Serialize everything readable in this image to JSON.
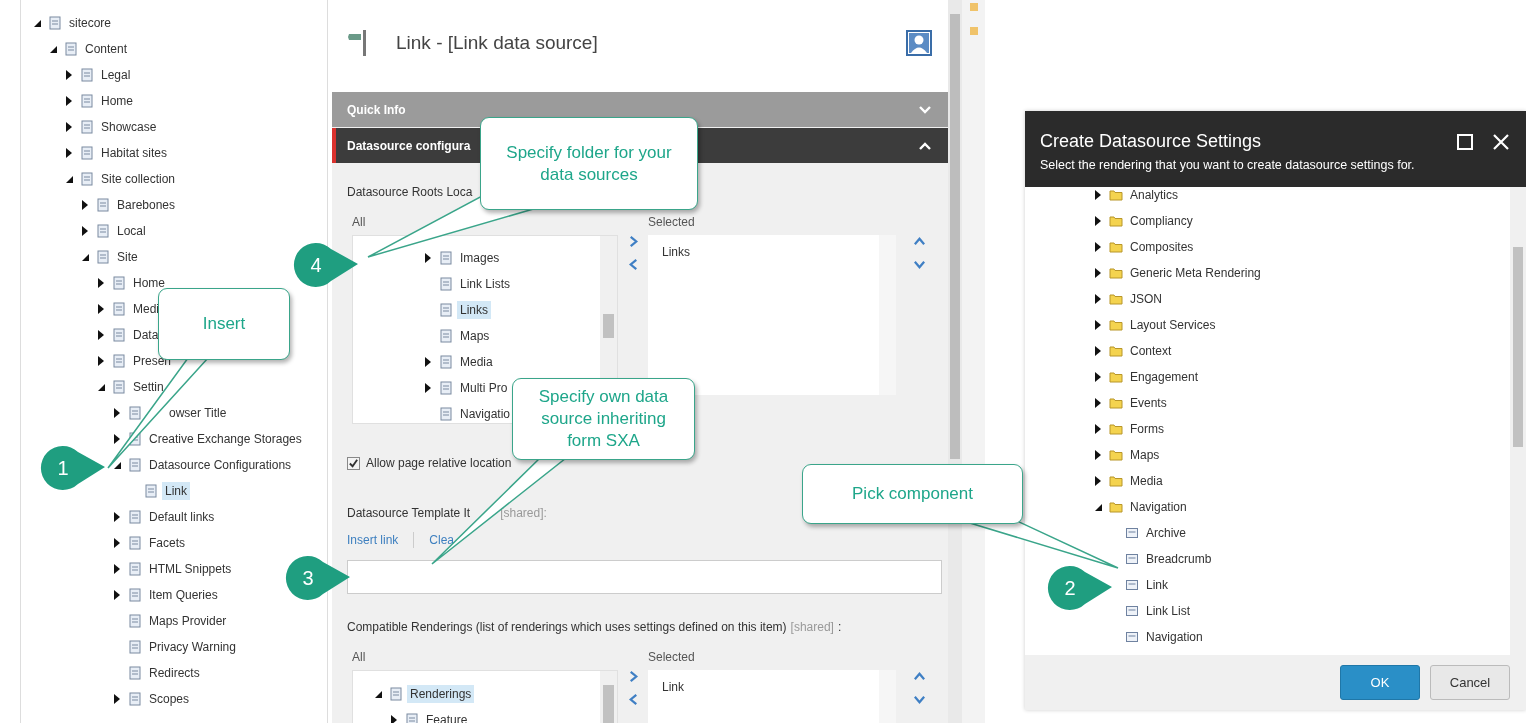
{
  "content_tree": {
    "items": [
      {
        "label": "sitecore",
        "expanded": true,
        "selected": false,
        "children": [
          {
            "label": "Content",
            "expanded": true,
            "selected": false,
            "children": [
              {
                "label": "Legal",
                "expanded": false,
                "selected": false
              },
              {
                "label": "Home",
                "expanded": false,
                "selected": false
              },
              {
                "label": "Showcase",
                "expanded": false,
                "selected": false
              },
              {
                "label": "Habitat sites",
                "expanded": false,
                "selected": false
              },
              {
                "label": "Site collection",
                "expanded": true,
                "selected": false,
                "children": [
                  {
                    "label": "Barebones",
                    "expanded": false,
                    "selected": false
                  },
                  {
                    "label": "Local",
                    "expanded": false,
                    "selected": false
                  },
                  {
                    "label": "Site",
                    "expanded": true,
                    "selected": false,
                    "children": [
                      {
                        "label": "Home",
                        "expanded": false,
                        "selected": false
                      },
                      {
                        "label": "Medi",
                        "expanded": false,
                        "selected": false
                      },
                      {
                        "label": "Data",
                        "expanded": false,
                        "selected": false
                      },
                      {
                        "label": "Presen",
                        "expanded": false,
                        "selected": false
                      },
                      {
                        "label": "Settin",
                        "expanded": true,
                        "selected": false,
                        "children": [
                          {
                            "label": "owser Title",
                            "expanded": false,
                            "selected": false
                          },
                          {
                            "label": "Creative Exchange Storages",
                            "expanded": false,
                            "selected": false
                          },
                          {
                            "label": "Datasource Configurations",
                            "expanded": true,
                            "selected": false,
                            "children": [
                              {
                                "label": "Link",
                                "selected": true
                              }
                            ]
                          },
                          {
                            "label": "Default links",
                            "expanded": false,
                            "selected": false
                          },
                          {
                            "label": "Facets",
                            "expanded": false,
                            "selected": false
                          },
                          {
                            "label": "HTML Snippets",
                            "expanded": false,
                            "selected": false
                          },
                          {
                            "label": "Item Queries",
                            "expanded": false,
                            "selected": false
                          },
                          {
                            "label": "Maps Provider",
                            "selected": false
                          },
                          {
                            "label": "Privacy Warning",
                            "selected": false
                          },
                          {
                            "label": "Redirects",
                            "selected": false
                          },
                          {
                            "label": "Scopes",
                            "expanded": false,
                            "selected": false
                          }
                        ]
                      }
                    ]
                  }
                ]
              }
            ]
          }
        ]
      }
    ]
  },
  "editor": {
    "title": "Link - [Link data source]",
    "sections": [
      {
        "title": "Quick Info",
        "expanded": false
      },
      {
        "title": "Datasource configura",
        "expanded": true
      }
    ],
    "roots_field": {
      "label": "Datasource Roots Loca",
      "all_label": "All",
      "selected_label": "Selected",
      "all_items": [
        {
          "label": "Images",
          "expanded": false,
          "selected": false
        },
        {
          "label": "Link Lists",
          "selected": false
        },
        {
          "label": "Links",
          "selected": true
        },
        {
          "label": "Maps",
          "selected": false
        },
        {
          "label": "Media",
          "expanded": false,
          "selected": false
        },
        {
          "label": "Multi Pro",
          "expanded": false,
          "selected": false
        },
        {
          "label": "Navigatio",
          "selected": false
        }
      ],
      "selected_items": [
        "Links"
      ]
    },
    "relative_location": {
      "label": "Allow page relative location",
      "checked": true
    },
    "template_field": {
      "label": "Datasource Template It",
      "shared": "[shared]:",
      "links": [
        "Insert link",
        "Clea"
      ]
    },
    "renderings_field": {
      "label": "Compatible Renderings (list of renderings which uses settings defined on this item)",
      "shared": "[shared]",
      "suffix": ":",
      "all_label": "All",
      "selected_label": "Selected",
      "all_items": [
        {
          "label": "Renderings",
          "expanded": true,
          "selected": true,
          "children": [
            {
              "label": "Feature",
              "expanded": false,
              "selected": false
            }
          ]
        }
      ],
      "selected_items": [
        "Link"
      ]
    }
  },
  "dialog": {
    "title": "Create Datasource Settings",
    "subtitle": "Select the rendering that you want to create datasource settings for.",
    "items": [
      {
        "kind": "folder",
        "label": "Analytics",
        "expanded": false,
        "selected": false
      },
      {
        "kind": "folder",
        "label": "Compliancy",
        "expanded": false,
        "selected": false
      },
      {
        "kind": "folder",
        "label": "Composites",
        "expanded": false,
        "selected": false
      },
      {
        "kind": "folder",
        "label": "Generic Meta Rendering",
        "expanded": false,
        "selected": false
      },
      {
        "kind": "folder",
        "label": "JSON",
        "expanded": false,
        "selected": false
      },
      {
        "kind": "folder",
        "label": "Layout Services",
        "expanded": false,
        "selected": false
      },
      {
        "kind": "folder",
        "label": "Context",
        "expanded": false,
        "selected": false
      },
      {
        "kind": "folder",
        "label": "Engagement",
        "expanded": false,
        "selected": false
      },
      {
        "kind": "folder",
        "label": "Events",
        "expanded": false,
        "selected": false
      },
      {
        "kind": "folder",
        "label": "Forms",
        "expanded": false,
        "selected": false
      },
      {
        "kind": "folder",
        "label": "Maps",
        "expanded": false,
        "selected": false
      },
      {
        "kind": "folder",
        "label": "Media",
        "expanded": false,
        "selected": false
      },
      {
        "kind": "folder",
        "label": "Navigation",
        "expanded": true,
        "selected": false,
        "children": [
          {
            "kind": "rendering",
            "label": "Archive",
            "selected": false
          },
          {
            "kind": "rendering",
            "label": "Breadcrumb",
            "selected": false
          },
          {
            "kind": "rendering",
            "label": "Link",
            "selected": false
          },
          {
            "kind": "rendering",
            "label": "Link List",
            "selected": false
          },
          {
            "kind": "rendering",
            "label": "Navigation",
            "selected": false
          }
        ]
      }
    ],
    "buttons": [
      "OK",
      "Cancel"
    ]
  },
  "callouts": [
    {
      "text": "Specify folder for your data sources"
    },
    {
      "text": "Insert"
    },
    {
      "text": "Specify own data source inheriting form SXA"
    },
    {
      "text": "Pick component"
    }
  ],
  "steps": [
    {
      "label": "1"
    },
    {
      "label": "2"
    },
    {
      "label": "3"
    },
    {
      "label": "4"
    }
  ]
}
